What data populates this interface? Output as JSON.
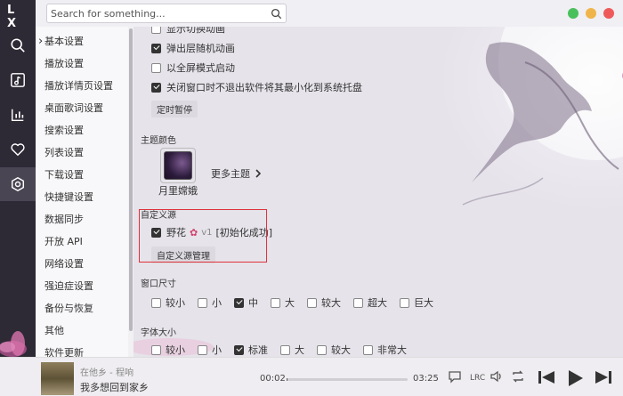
{
  "app": {
    "logo": "L X"
  },
  "rail": {
    "items": [
      "search-icon",
      "music-list-icon",
      "leaderboard-icon",
      "heart-icon",
      "settings-icon"
    ],
    "active": 4
  },
  "search": {
    "placeholder": "Search for something..."
  },
  "colors": {
    "rail_bg": "#2e2a35",
    "accent": "#333333",
    "highlight_box": "#e0313a",
    "close": "#ee5a5a",
    "maximize": "#f0b54a",
    "minimize": "#4ac05d"
  },
  "nav": {
    "items": [
      "基本设置",
      "播放设置",
      "播放详情页设置",
      "桌面歌词设置",
      "搜索设置",
      "列表设置",
      "下载设置",
      "快捷键设置",
      "数据同步",
      "开放 API",
      "网络设置",
      "强迫症设置",
      "备份与恢复",
      "其他",
      "软件更新"
    ],
    "active_index": 0
  },
  "basic": {
    "cutoff_label": "显示切换动画",
    "popup_animation": {
      "label": "弹出层随机动画",
      "checked": true
    },
    "fullscreen_start": {
      "label": "以全屏模式启动",
      "checked": false
    },
    "tray_minimize": {
      "label": "关闭窗口时不退出软件将其最小化到系统托盘",
      "checked": true
    },
    "timer_button": "定时暂停"
  },
  "theme": {
    "section_title": "主题颜色",
    "current_name": "月里嫦娥",
    "more_label": "更多主题"
  },
  "custom_source": {
    "section_title": "自定义源",
    "source_name": "野花",
    "version": "v1",
    "status": "[初始化成功]",
    "checked": true,
    "manage_button": "自定义源管理"
  },
  "window_size": {
    "section_title": "窗口尺寸",
    "options": [
      "较小",
      "小",
      "中",
      "大",
      "较大",
      "超大",
      "巨大"
    ],
    "selected": "中"
  },
  "font_size": {
    "section_title": "字体大小",
    "options": [
      "较小",
      "小",
      "标准",
      "大",
      "较大",
      "非常大"
    ],
    "selected": "标准"
  },
  "player": {
    "artist_line": "在他乡 - 程响",
    "lyric_line": "我多想回到家乡",
    "current_time": "00:02",
    "total_time": "03:25",
    "progress": 0.01
  }
}
